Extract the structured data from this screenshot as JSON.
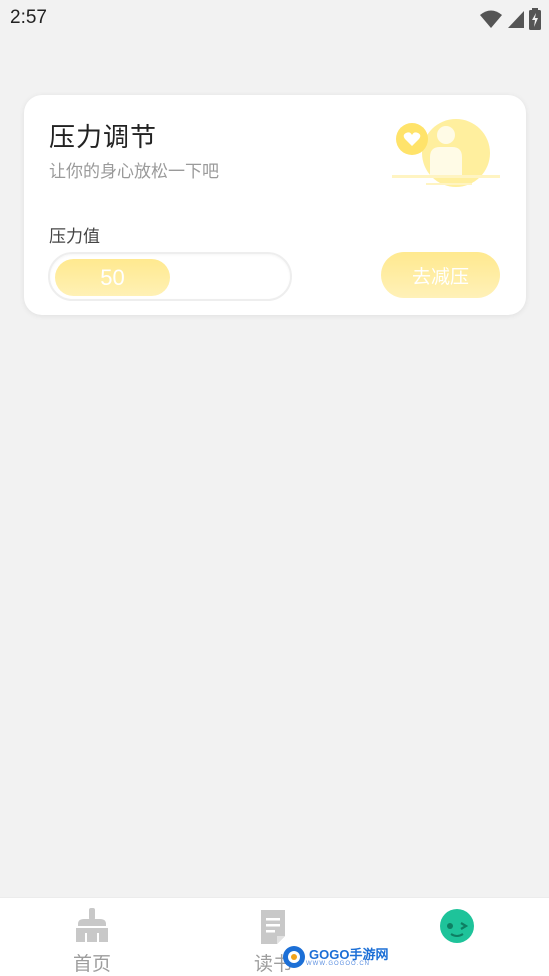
{
  "status_bar": {
    "time": "2:57",
    "icons": [
      "wifi-icon",
      "signal-icon",
      "battery-charging-icon"
    ]
  },
  "card": {
    "title": "压力调节",
    "subtitle": "让你的身心放松一下吧",
    "illustration": "person-heart-illustration",
    "pressure_label": "压力值",
    "pressure_value": "50",
    "pressure_fill_fraction": 0.5,
    "relieve_button_label": "去减压"
  },
  "colors": {
    "accent_yellow": "#ffe98f",
    "background": "#f2f2f2",
    "card": "#ffffff",
    "teal": "#1ec39a"
  },
  "bottom_nav": {
    "items": [
      {
        "label": "首页",
        "icon": "broom-icon"
      },
      {
        "label": "读书",
        "icon": "document-icon"
      },
      {
        "label": "",
        "icon": "smiley-face-icon"
      }
    ]
  },
  "watermark": {
    "text": "GOGO手游网",
    "sub": "WWW.GOGOO.CN"
  }
}
